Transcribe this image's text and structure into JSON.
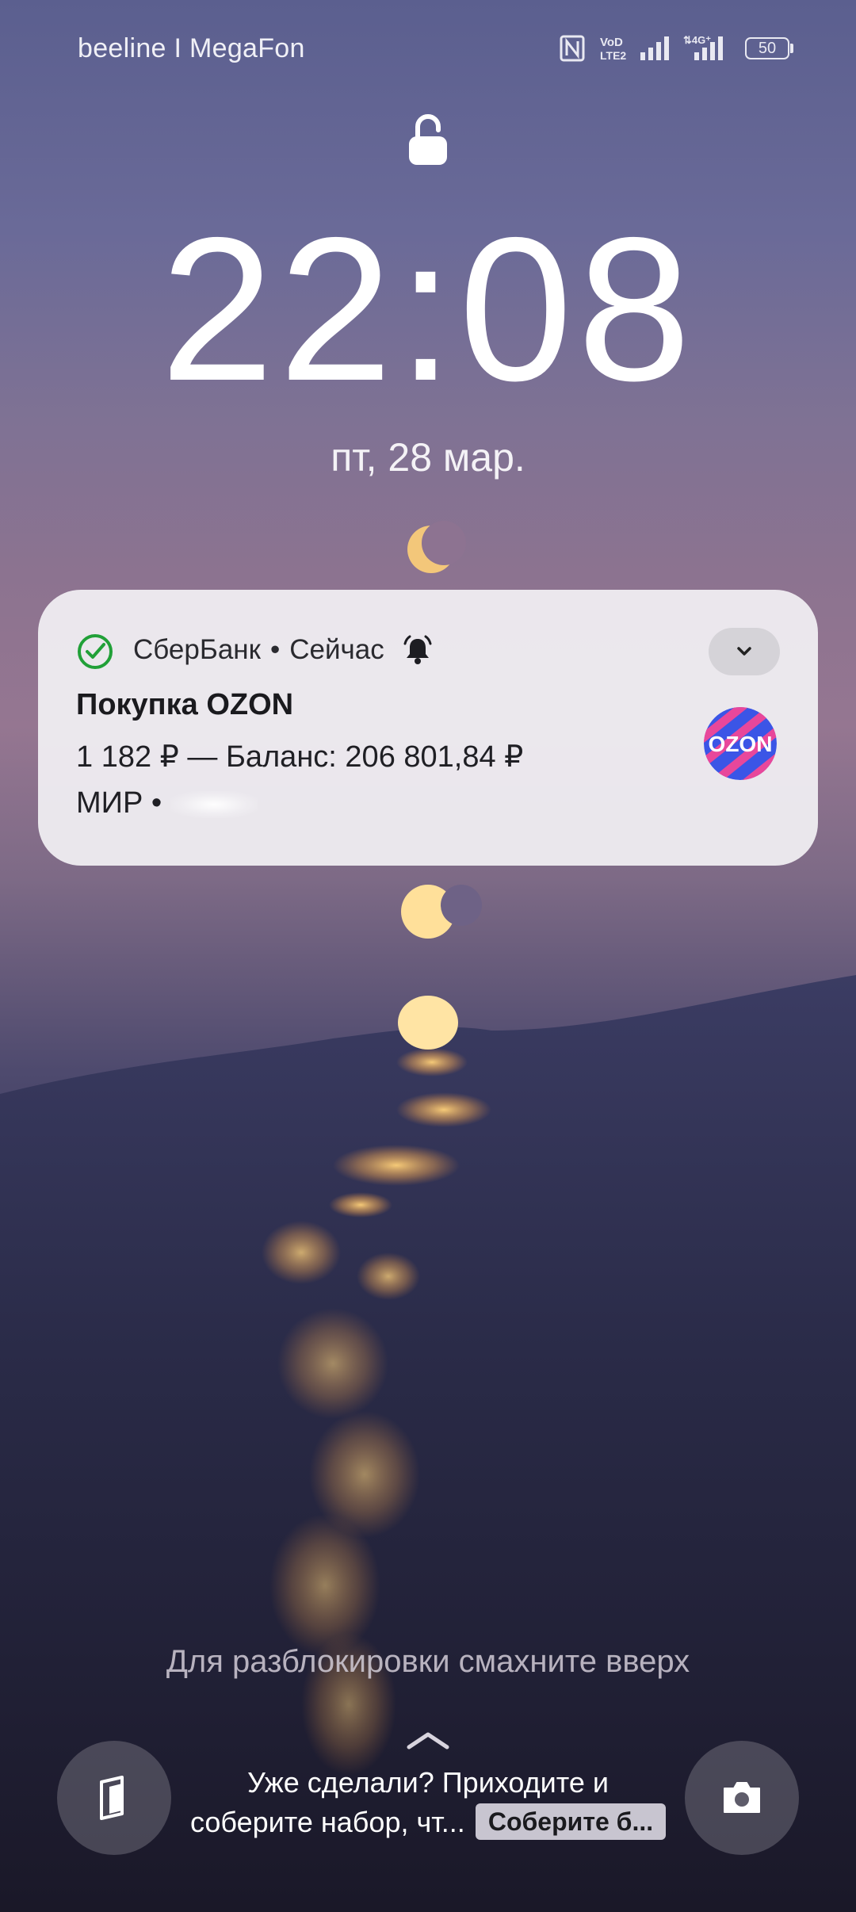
{
  "status_bar": {
    "carrier": "beeline I MegaFon",
    "battery": "50",
    "icons": [
      "nfc-icon",
      "volte-icon",
      "signal-icon",
      "4g-signal-icon",
      "battery-icon"
    ]
  },
  "lock_icon": "lock-icon",
  "clock": {
    "time": "22:08",
    "date": "пт, 28 мар."
  },
  "notification": {
    "app_name": "СберБанк",
    "time": "Сейчас",
    "title": "Покупка OZON",
    "line1": "1 182 ₽ — Баланс: 206 801,84 ₽",
    "line2": "МИР •",
    "app_icon": "sber-check-icon",
    "logo": "ozon-logo",
    "accent": "#21a038"
  },
  "unlock_hint": "Для разблокировки смахните вверх",
  "bottom": {
    "promo_line1": "Уже сделали? Приходите и",
    "promo_line2": "соберите набор, чт...",
    "promo_chip": "Соберите б...",
    "left_button_icon": "flashlight-icon",
    "right_button_icon": "camera-icon"
  }
}
